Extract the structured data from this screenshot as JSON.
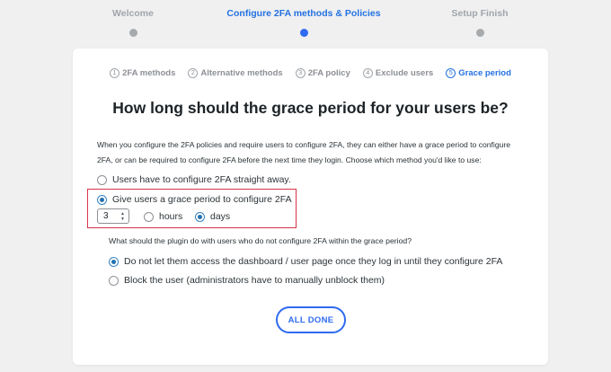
{
  "wizard": {
    "steps": [
      {
        "label": "Welcome"
      },
      {
        "label": "Configure 2FA methods & Policies"
      },
      {
        "label": "Setup Finish"
      }
    ]
  },
  "substeps": [
    {
      "num": "1",
      "label": "2FA methods"
    },
    {
      "num": "2",
      "label": "Alternative methods"
    },
    {
      "num": "3",
      "label": "2FA policy"
    },
    {
      "num": "4",
      "label": "Exclude users"
    },
    {
      "num": "5",
      "label": "Grace period"
    }
  ],
  "main": {
    "heading": "How long should the grace period for your users be?",
    "description": "When you configure the 2FA policies and require users to configure 2FA, they can either have a grace period to configure 2FA, or can be required to configure 2FA before the next time they login. Choose which method you'd like to use:",
    "option_immediate": "Users have to configure 2FA straight away.",
    "option_grace": "Give users a grace period to configure 2FA",
    "grace_value": "3",
    "unit_hours": "hours",
    "unit_days": "days",
    "question": "What should the plugin do with users who do not configure 2FA within the grace period?",
    "action_block_access": "Do not let them access the dashboard / user page once they log in until they configure 2FA",
    "action_block_user": "Block the user (administrators have to manually unblock them)",
    "done_label": "ALL DONE"
  },
  "colors": {
    "accent": "#2f6bf0",
    "highlight_border": "#d6344a",
    "inactive": "#a7aaad"
  }
}
